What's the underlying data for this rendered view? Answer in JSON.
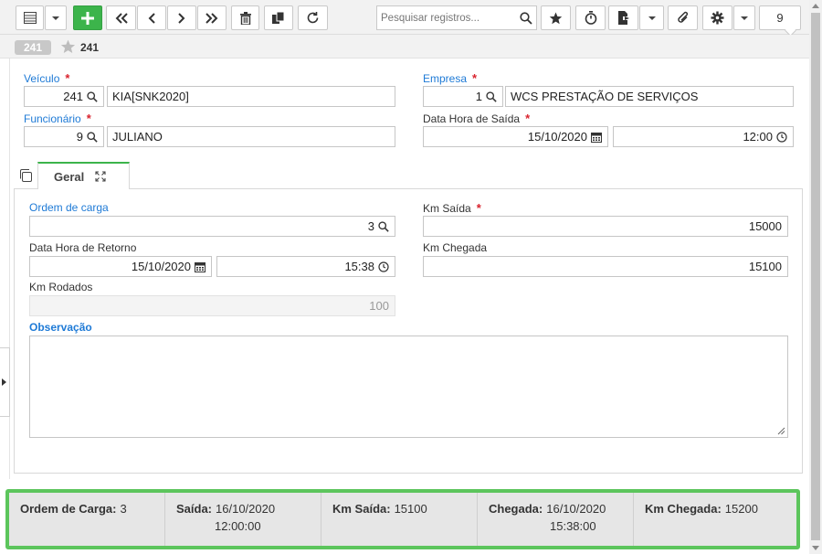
{
  "toolbar": {
    "search_placeholder": "Pesquisar registros...",
    "record_count": "9",
    "icons": [
      "grid-icon",
      "caret-icon",
      "plus-icon",
      "first-icon",
      "prev-icon",
      "next-icon",
      "last-icon",
      "trash-icon",
      "copy-icon",
      "refresh-icon",
      "search-icon",
      "star-icon",
      "stopwatch-icon",
      "export-icon",
      "caret-icon",
      "paperclip-icon",
      "gear-icon",
      "caret-icon"
    ],
    "accent_color": "#3cb44b"
  },
  "record": {
    "badge": "241",
    "number": "241"
  },
  "form": {
    "veiculo": {
      "label": "Veículo",
      "code": "241",
      "name": "KIA[SNK2020]"
    },
    "empresa": {
      "label": "Empresa",
      "code": "1",
      "name": "WCS PRESTAÇÃO DE SERVIÇOS"
    },
    "funcionario": {
      "label": "Funcionário",
      "code": "9",
      "name": "JULIANO"
    },
    "data_hora_saida": {
      "label": "Data Hora de Saída",
      "date": "15/10/2020",
      "time": "12:00"
    },
    "required_mark": "*"
  },
  "tab": {
    "label": "Geral"
  },
  "geral": {
    "ordem_carga": {
      "label": "Ordem de carga",
      "value": "3"
    },
    "km_saida": {
      "label": "Km Saída",
      "value": "15000"
    },
    "data_hora_retorno": {
      "label": "Data Hora de Retorno",
      "date": "15/10/2020",
      "time": "15:38"
    },
    "km_chegada": {
      "label": "Km Chegada",
      "value": "15100"
    },
    "km_rodados": {
      "label": "Km Rodados",
      "value": "100"
    },
    "observacao": {
      "label": "Observação",
      "value": ""
    }
  },
  "summary": [
    {
      "label": "Ordem de Carga:",
      "value": "3",
      "value2": ""
    },
    {
      "label": "Saída:",
      "value": "16/10/2020",
      "value2": "12:00:00"
    },
    {
      "label": "Km Saída:",
      "value": "15100",
      "value2": ""
    },
    {
      "label": "Chegada:",
      "value": "16/10/2020",
      "value2": "15:38:00"
    },
    {
      "label": "Km Chegada:",
      "value": "15200",
      "value2": ""
    }
  ],
  "summary_border_color": "#5cc55c"
}
